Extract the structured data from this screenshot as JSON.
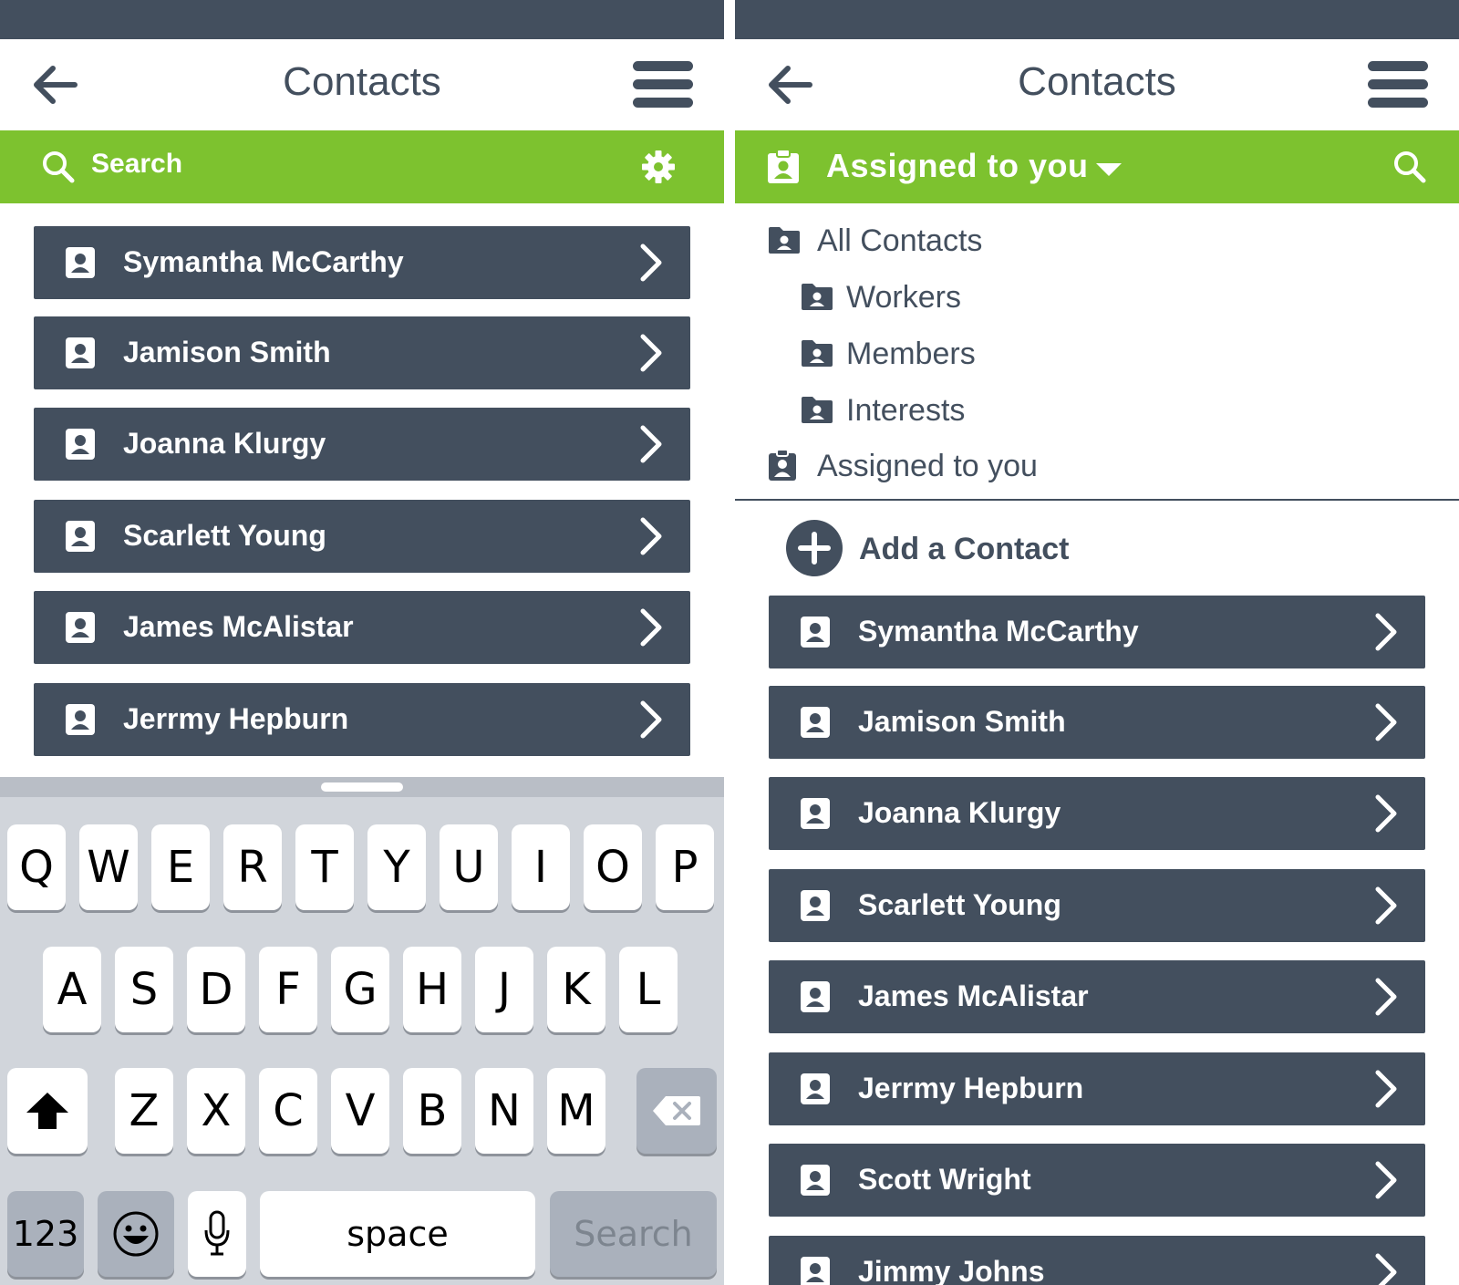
{
  "left": {
    "title": "Contacts",
    "search_label": "Search",
    "contacts": [
      "Symantha McCarthy",
      "Jamison Smith",
      "Joanna Klurgy",
      "Scarlett Young",
      "James McAlistar",
      "Jerrmy Hepburn"
    ],
    "keyboard": {
      "row1": [
        "Q",
        "W",
        "E",
        "R",
        "T",
        "Y",
        "U",
        "I",
        "O",
        "P"
      ],
      "row2": [
        "A",
        "S",
        "D",
        "F",
        "G",
        "H",
        "J",
        "K",
        "L"
      ],
      "row3": [
        "Z",
        "X",
        "C",
        "V",
        "B",
        "N",
        "M"
      ],
      "numbers_label": "123",
      "space_label": "space",
      "search_key_label": "Search"
    }
  },
  "right": {
    "title": "Contacts",
    "filter_label": "Assigned to you",
    "menu": {
      "all_contacts": "All Contacts",
      "workers": "Workers",
      "members": "Members",
      "interests": "Interests",
      "assigned": "Assigned to you"
    },
    "add_contact_label": "Add a Contact",
    "contacts": [
      "Symantha McCarthy",
      "Jamison Smith",
      "Joanna Klurgy",
      "Scarlett Young",
      "James McAlistar",
      "Jerrmy Hepburn",
      "Scott Wright",
      "Jimmy Johns"
    ]
  },
  "colors": {
    "primary_dark": "#434f5e",
    "accent_green": "#7dc22f",
    "keyboard_bg": "#d1d5db"
  },
  "icons": {
    "back": "arrow-left-icon",
    "menu": "hamburger-menu-icon",
    "search": "search-icon",
    "settings": "gear-icon",
    "contact": "contact-card-icon",
    "chevron": "chevron-right-icon",
    "folder": "contact-folder-icon",
    "clipboard": "assigned-clipboard-icon",
    "add": "plus-circle-icon",
    "shift": "shift-icon",
    "delete": "backspace-icon",
    "emoji": "emoji-icon",
    "microphone": "microphone-icon"
  }
}
